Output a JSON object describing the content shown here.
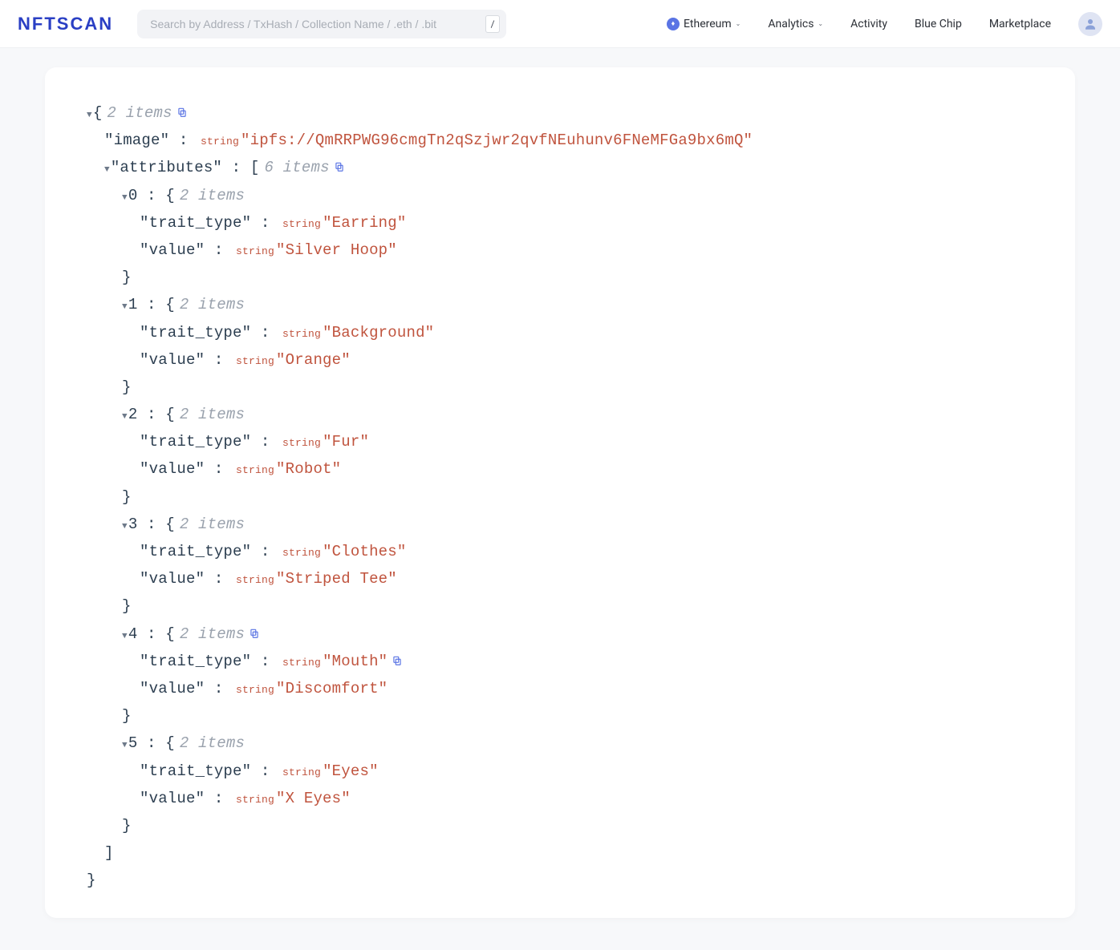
{
  "logo": "NFTSCAN",
  "search": {
    "placeholder": "Search by Address / TxHash / Collection Name / .eth / .bit",
    "hint": "/"
  },
  "nav": {
    "chain": "Ethereum",
    "analytics": "Analytics",
    "activity": "Activity",
    "bluechip": "Blue Chip",
    "marketplace": "Marketplace"
  },
  "json": {
    "root_meta": "2 items",
    "image_key": "\"image\"",
    "image_val": "\"ipfs://QmRRPWG96cmgTn2qSzjwr2qvfNEuhunv6FNeMFGa9bx6mQ\"",
    "attr_key": "\"attributes\"",
    "attr_meta": "6 items",
    "type_label": "string",
    "items": [
      {
        "idx": "0",
        "meta": "2 items",
        "ttype": "\"Earring\"",
        "val": "\"Silver Hoop\"",
        "copy": false
      },
      {
        "idx": "1",
        "meta": "2 items",
        "ttype": "\"Background\"",
        "val": "\"Orange\"",
        "copy": false
      },
      {
        "idx": "2",
        "meta": "2 items",
        "ttype": "\"Fur\"",
        "val": "\"Robot\"",
        "copy": false
      },
      {
        "idx": "3",
        "meta": "2 items",
        "ttype": "\"Clothes\"",
        "val": "\"Striped Tee\"",
        "copy": false
      },
      {
        "idx": "4",
        "meta": "2 items",
        "ttype": "\"Mouth\"",
        "val": "\"Discomfort\"",
        "copy": true
      },
      {
        "idx": "5",
        "meta": "2 items",
        "ttype": "\"Eyes\"",
        "val": "\"X Eyes\"",
        "copy": false
      }
    ],
    "trait_key": "\"trait_type\"",
    "value_key": "\"value\""
  }
}
